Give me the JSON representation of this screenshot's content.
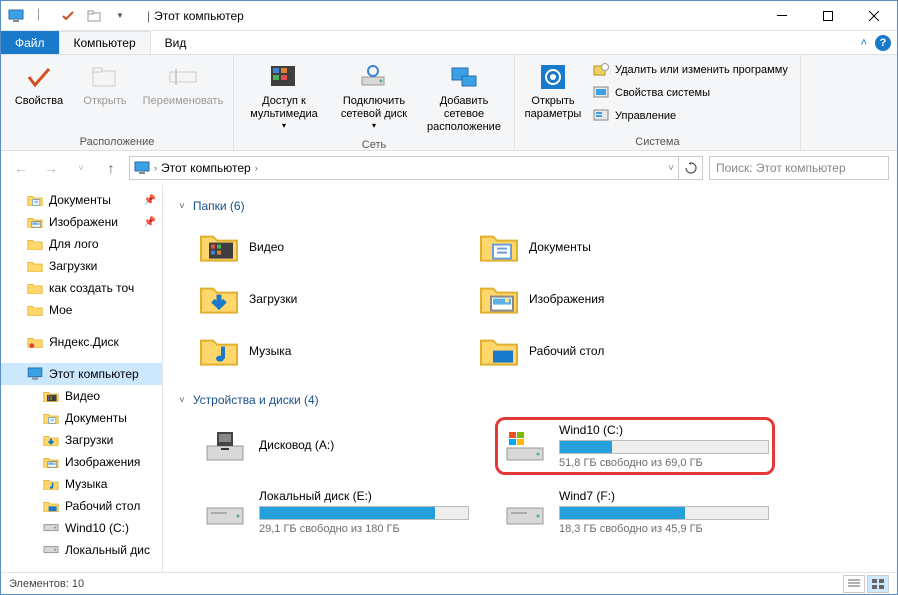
{
  "title": "Этот компьютер",
  "tabs": {
    "file": "Файл",
    "computer": "Компьютер",
    "view": "Вид"
  },
  "ribbon": {
    "location": {
      "label": "Расположение",
      "properties": "Свойства",
      "open": "Открыть",
      "rename": "Переименовать"
    },
    "network": {
      "label": "Сеть",
      "media": "Доступ к мультимедиа",
      "mapdrive": "Подключить сетевой диск",
      "addnet": "Добавить сетевое расположение"
    },
    "system": {
      "label": "Система",
      "settings": "Открыть параметры",
      "uninstall": "Удалить или изменить программу",
      "sysprops": "Свойства системы",
      "manage": "Управление"
    }
  },
  "breadcrumb": "Этот компьютер",
  "search_placeholder": "Поиск: Этот компьютер",
  "sidebar": [
    {
      "label": "Документы",
      "icon": "doc",
      "pinned": true
    },
    {
      "label": "Изображени",
      "icon": "img",
      "pinned": true
    },
    {
      "label": "Для лого",
      "icon": "folder"
    },
    {
      "label": "Загрузки",
      "icon": "folder"
    },
    {
      "label": "как создать точ",
      "icon": "folder"
    },
    {
      "label": "Мое",
      "icon": "folder"
    },
    {
      "label": "Яндекс.Диск",
      "icon": "yadisk",
      "spaced": true
    },
    {
      "label": "Этот компьютер",
      "icon": "pc",
      "selected": true,
      "spaced": true
    },
    {
      "label": "Видео",
      "icon": "video",
      "indent": true
    },
    {
      "label": "Документы",
      "icon": "doc",
      "indent": true
    },
    {
      "label": "Загрузки",
      "icon": "down",
      "indent": true
    },
    {
      "label": "Изображения",
      "icon": "img",
      "indent": true
    },
    {
      "label": "Музыка",
      "icon": "music",
      "indent": true
    },
    {
      "label": "Рабочий стол",
      "icon": "desktop",
      "indent": true
    },
    {
      "label": "Wind10 (C:)",
      "icon": "drive",
      "indent": true
    },
    {
      "label": "Локальный дис",
      "icon": "drive",
      "indent": true
    }
  ],
  "groups": {
    "folders": {
      "title": "Папки (6)",
      "items": [
        {
          "label": "Видео",
          "icon": "video"
        },
        {
          "label": "Документы",
          "icon": "doc"
        },
        {
          "label": "Загрузки",
          "icon": "down"
        },
        {
          "label": "Изображения",
          "icon": "img"
        },
        {
          "label": "Музыка",
          "icon": "music"
        },
        {
          "label": "Рабочий стол",
          "icon": "desktop"
        }
      ]
    },
    "drives": {
      "title": "Устройства и диски (4)",
      "items": [
        {
          "label": "Дисковод (A:)",
          "type": "floppy"
        },
        {
          "label": "Wind10 (C:)",
          "type": "os",
          "free": "51,8 ГБ свободно из 69,0 ГБ",
          "fill": 25,
          "highlighted": true
        },
        {
          "label": "Локальный диск (E:)",
          "type": "hdd",
          "free": "29,1 ГБ свободно из 180 ГБ",
          "fill": 84
        },
        {
          "label": "Wind7 (F:)",
          "type": "hdd",
          "free": "18,3 ГБ свободно из 45,9 ГБ",
          "fill": 60
        }
      ]
    }
  },
  "status": "Элементов: 10"
}
